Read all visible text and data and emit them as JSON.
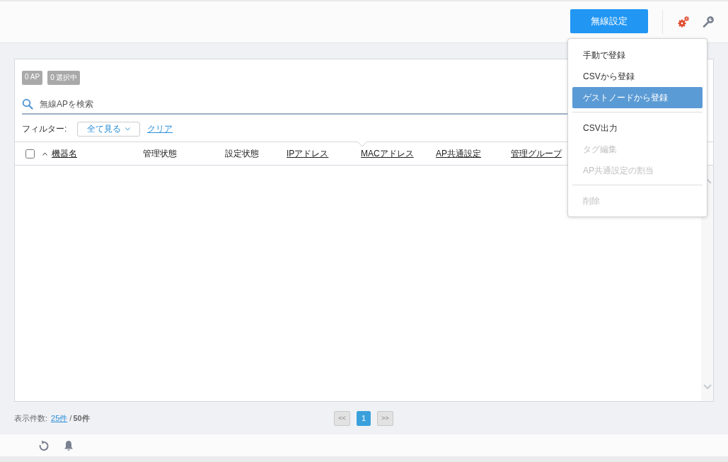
{
  "header": {
    "wireless_button": "無線設定"
  },
  "panel": {
    "badges": [
      "0 AP",
      "0 選択中"
    ],
    "search": {
      "placeholder": "無線APを検索"
    },
    "filter": {
      "label": "フィルター:",
      "dropdown": "全て見る",
      "clear": "クリア"
    },
    "table": {
      "select_all": {
        "checked": false
      },
      "columns": [
        {
          "label": "機器名",
          "link": true,
          "sort_ascending": true
        },
        {
          "label": "管理状態",
          "link": false
        },
        {
          "label": "設定状態",
          "link": false
        },
        {
          "label": "IPアドレス",
          "link": true
        },
        {
          "label": "MACアドレス",
          "link": true
        },
        {
          "label": "AP共通設定",
          "link": true
        },
        {
          "label": "管理グループ",
          "link": true
        }
      ]
    }
  },
  "footer": {
    "label": "表示件数:",
    "page_size": "25件",
    "separator": "/",
    "total": "50件"
  },
  "pagination": {
    "prev": "<<",
    "pages": [
      {
        "label": "1",
        "selected": true
      }
    ],
    "next": ">>"
  },
  "menu": {
    "items": [
      {
        "kind": "item",
        "label": "手動で登録",
        "disabled": false,
        "selected": false
      },
      {
        "kind": "item",
        "label": "CSVから登録",
        "disabled": false,
        "selected": false
      },
      {
        "kind": "item",
        "label": "ゲストノードから登録",
        "disabled": false,
        "selected": true
      },
      {
        "kind": "divider"
      },
      {
        "kind": "item",
        "label": "CSV出力",
        "disabled": false,
        "selected": false
      },
      {
        "kind": "item",
        "label": "タグ編集",
        "disabled": true,
        "selected": false
      },
      {
        "kind": "item",
        "label": "AP共通設定の割当",
        "disabled": true,
        "selected": false
      },
      {
        "kind": "divider"
      },
      {
        "kind": "item",
        "label": "削除",
        "disabled": true,
        "selected": false
      }
    ]
  }
}
